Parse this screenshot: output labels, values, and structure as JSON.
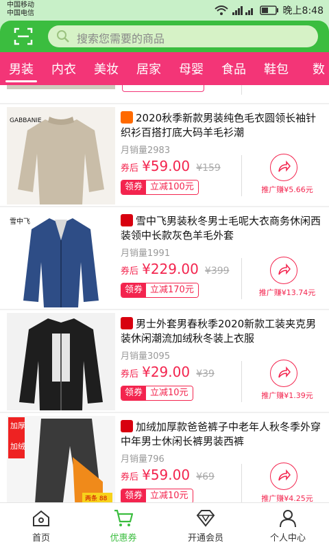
{
  "status_bar": {
    "carrier1": "中国移动",
    "carrier2": "中国电信",
    "time": "晚上8:48"
  },
  "search": {
    "placeholder": "搜索您需要的商品"
  },
  "tabs": [
    "男装",
    "内衣",
    "美妆",
    "居家",
    "母婴",
    "食品",
    "鞋包",
    "数"
  ],
  "active_tab": "男装",
  "colors": {
    "accent": "#f33577",
    "header": "#3bbd3f",
    "price": "#f3244e"
  },
  "items": [
    {
      "shop": "taobao",
      "brand_mark": "GABBANIE",
      "title": "2020秋季新款男装纯色毛衣圆领长袖针织衫百搭打底大码羊毛衫潮",
      "sales": "月销量2983",
      "price_label": "券后",
      "price": "¥59.00",
      "original": "¥159",
      "coupon_tag": "领券",
      "coupon_amount": "立减100元",
      "earn": "推广赚¥5.66元"
    },
    {
      "shop": "tmall",
      "brand_mark": "雪中飞",
      "title": "雪中飞男装秋冬男士毛呢大衣商务休闲西装领中长款灰色羊毛外套",
      "sales": "月销量1991",
      "price_label": "券后",
      "price": "¥229.00",
      "original": "¥399",
      "coupon_tag": "领券",
      "coupon_amount": "立减170元",
      "earn": "推广赚¥13.74元"
    },
    {
      "shop": "tmall",
      "brand_mark": "",
      "title": "男士外套男春秋季2020新款工装夹克男装休闲潮流加绒秋冬装上衣服",
      "sales": "月销量3095",
      "price_label": "券后",
      "price": "¥29.00",
      "original": "¥39",
      "coupon_tag": "领券",
      "coupon_amount": "立减10元",
      "earn": "推广赚¥1.39元"
    },
    {
      "shop": "tmall",
      "brand_mark": "加厚加绒",
      "title": "加绒加厚款爸爸裤子中老年人秋冬季外穿中年男士休闲长裤男装西裤",
      "sales": "月销量796",
      "price_label": "券后",
      "price": "¥59.00",
      "original": "¥69",
      "coupon_tag": "领券",
      "coupon_amount": "立减10元",
      "earn": "推广赚¥4.25元",
      "promo": "两条 88"
    }
  ],
  "bottom_nav": [
    {
      "label": "首页",
      "icon": "home-icon"
    },
    {
      "label": "优惠券",
      "icon": "cart-icon"
    },
    {
      "label": "开通会员",
      "icon": "diamond-icon"
    },
    {
      "label": "个人中心",
      "icon": "person-icon"
    }
  ],
  "active_nav": "优惠券"
}
